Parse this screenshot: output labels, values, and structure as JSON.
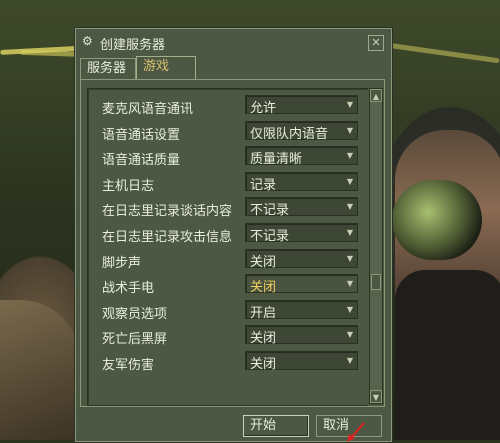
{
  "window": {
    "title": "创建服务器",
    "close_label": "✕"
  },
  "tabs": [
    {
      "label": "服务器",
      "active": false
    },
    {
      "label": "游戏",
      "active": true
    }
  ],
  "settings": [
    {
      "label": "麦克风语音通讯",
      "value": "允许"
    },
    {
      "label": "语音通话设置",
      "value": "仅限队内语音"
    },
    {
      "label": "语音通话质量",
      "value": "质量清晰"
    },
    {
      "label": "主机日志",
      "value": "记录"
    },
    {
      "label": "在日志里记录谈话内容",
      "value": "不记录"
    },
    {
      "label": "在日志里记录攻击信息",
      "value": "不记录"
    },
    {
      "label": "脚步声",
      "value": "关闭"
    },
    {
      "label": "战术手电",
      "value": "关闭",
      "highlighted": true
    },
    {
      "label": "观察员选项",
      "value": "开启"
    },
    {
      "label": "死亡后黑屏",
      "value": "关闭"
    },
    {
      "label": "友军伤害",
      "value": "关闭"
    }
  ],
  "buttons": {
    "start": "开始",
    "cancel": "取消"
  },
  "icons": {
    "title": "steam-icon",
    "dropdown": "chevron-down-icon",
    "scroll_up": "triangle-up-icon",
    "scroll_down": "triangle-down-icon"
  },
  "colors": {
    "dialog_bg": "#4c5844",
    "active_tab_text": "#d8c070",
    "highlight_value": "#f0d060",
    "annotation_arrow": "#e02020"
  }
}
